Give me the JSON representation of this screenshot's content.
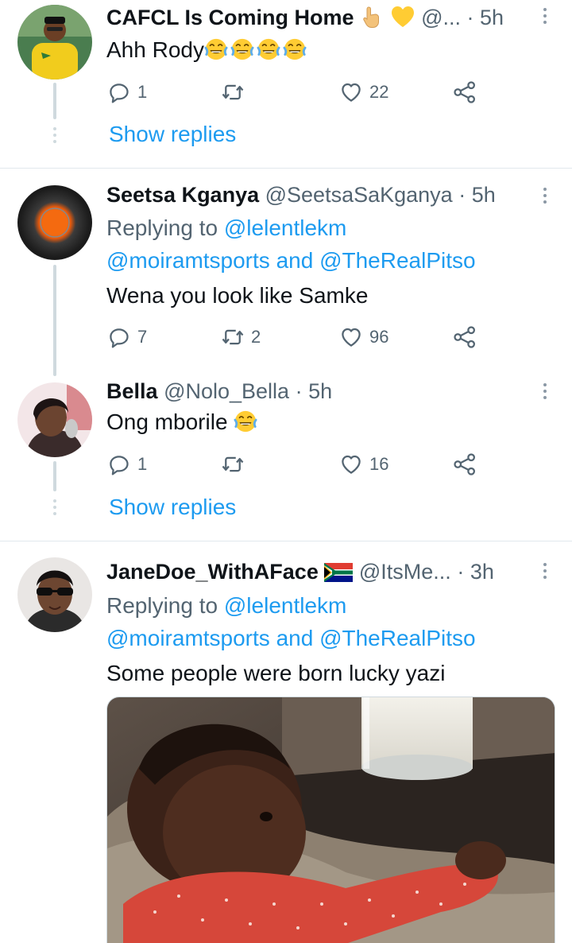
{
  "tweets": [
    {
      "name": "CAFCL Is Coming Home",
      "handle": "@...",
      "time": "5h",
      "text": "Ahh Rody",
      "replies": "1",
      "retweets": "",
      "likes": "22",
      "show_replies": "Show replies"
    },
    {
      "name": "Seetsa Kganya",
      "handle": "@SeetsaSaKganya",
      "time": "5h",
      "replying_label": "Replying to",
      "mention1": "@lelentlekm",
      "mention2": "@moiramtsports",
      "and_label": "and",
      "mention3": "@TheRealPitso",
      "text": "Wena you look like Samke",
      "replies": "7",
      "retweets": "2",
      "likes": "96"
    },
    {
      "name": "Bella",
      "handle": "@Nolo_Bella",
      "time": "5h",
      "text": "Ong mborile",
      "replies": "1",
      "retweets": "",
      "likes": "16",
      "show_replies": "Show replies"
    },
    {
      "name": "JaneDoe_WithAFace",
      "handle": "@ItsMe...",
      "time": "3h",
      "replying_label": "Replying to",
      "mention1": "@lelentlekm",
      "mention2": "@moiramtsports",
      "and_label": "and",
      "mention3": "@TheRealPitso",
      "text": "Some people were born lucky yazi"
    }
  ],
  "separator": "·",
  "colors": {
    "accent": "#1d9bf0",
    "text": "#0f1419",
    "muted": "#536471",
    "line": "#cfd9de"
  }
}
